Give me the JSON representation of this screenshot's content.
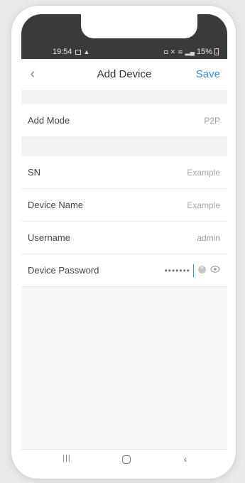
{
  "status_bar": {
    "time": "19:54",
    "battery_percent": "15%"
  },
  "header": {
    "title": "Add Device",
    "save_label": "Save"
  },
  "add_mode": {
    "label": "Add Mode",
    "value": "P2P"
  },
  "fields": {
    "sn": {
      "label": "SN",
      "placeholder": "Example"
    },
    "device_name": {
      "label": "Device Name",
      "placeholder": "Example"
    },
    "username": {
      "label": "Username",
      "value": "admin"
    },
    "device_password": {
      "label": "Device Password",
      "value": "•••••••"
    }
  },
  "colors": {
    "accent": "#3a8ed6",
    "status_bar_bg": "#3a3a3c"
  },
  "icons": [
    "back-chevron-icon",
    "clear-icon",
    "eye-icon",
    "recent-apps-icon",
    "home-icon",
    "nav-back-icon"
  ]
}
